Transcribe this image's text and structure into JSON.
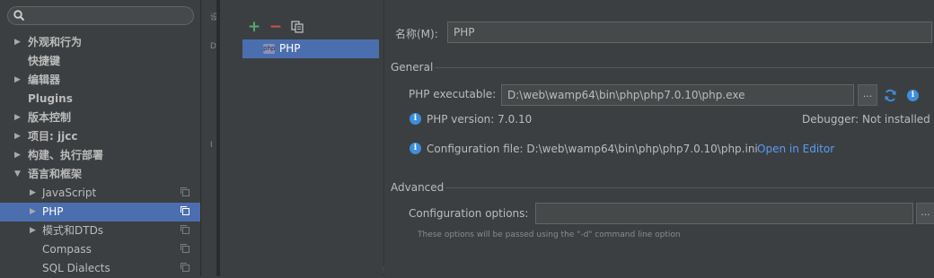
{
  "search": {
    "placeholder": ""
  },
  "tree": [
    {
      "label": "外观和行为",
      "arrow": "▶",
      "bold": true
    },
    {
      "label": "快捷键",
      "arrow": "",
      "bold": true
    },
    {
      "label": "编辑器",
      "arrow": "▶",
      "bold": true
    },
    {
      "label": "Plugins",
      "arrow": "",
      "bold": true
    },
    {
      "label": "版本控制",
      "arrow": "▶",
      "bold": true
    },
    {
      "label": "项目: jjcc",
      "arrow": "▶",
      "bold": true
    },
    {
      "label": "构建、执行部署",
      "arrow": "▶",
      "bold": true
    },
    {
      "label": "语言和框架",
      "arrow": "▼",
      "bold": true
    },
    {
      "label": "JavaScript",
      "arrow": "▶",
      "bold": false,
      "copy": true
    },
    {
      "label": "PHP",
      "arrow": "▶",
      "bold": false,
      "copy": true,
      "selected": true
    },
    {
      "label": "模式和DTDs",
      "arrow": "▶",
      "bold": false,
      "copy": true
    },
    {
      "label": "Compass",
      "arrow": "",
      "bold": false,
      "copy": true
    },
    {
      "label": "SQL Dialects",
      "arrow": "",
      "bold": false,
      "copy": true
    }
  ],
  "strip": {
    "c1": "设",
    "c2": "D",
    "c3": "I"
  },
  "toolbar": {
    "add": "+",
    "remove": "−"
  },
  "interpreters": [
    {
      "name": "PHP",
      "icon": "php"
    }
  ],
  "form": {
    "name_label": "名称(M):",
    "name_value": "PHP",
    "general_title": "General",
    "exe_label": "PHP executable:",
    "exe_value": "D:\\web\\wamp64\\bin\\php\\php7.0.10\\php.exe",
    "dots": "...",
    "php_version": "PHP version: 7.0.10",
    "debugger": "Debugger: Not installed",
    "config_file": "Configuration file: D:\\web\\wamp64\\bin\\php\\php7.0.10\\php.ini",
    "open_editor": "Open in Editor",
    "advanced_title": "Advanced",
    "options_label": "Configuration options:",
    "options_value": "",
    "options_hint": "These options will be passed using the \"-d\" command line option"
  },
  "colors": {
    "accent": "#4b6eaf",
    "link": "#589df6",
    "info": "#3e8edb",
    "add": "#59a869",
    "remove": "#c75450"
  }
}
